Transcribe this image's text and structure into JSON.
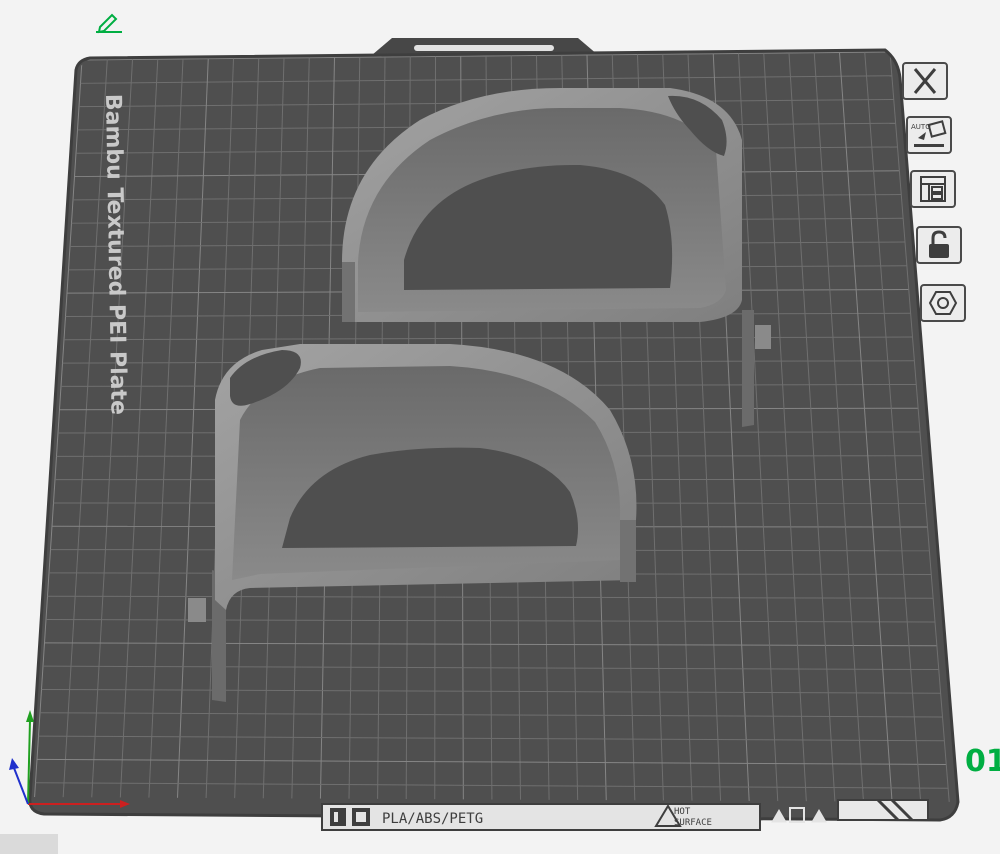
{
  "plate": {
    "name": "Bambu Textured PEI Plate",
    "filament_label": "PLA/ABS/PETG",
    "hot_surface_line1": "HOT",
    "hot_surface_line2": "SURFACE",
    "plate_number": "01"
  },
  "toolbar": {
    "buttons": [
      {
        "name": "close-plate-button",
        "icon": "x-icon"
      },
      {
        "name": "auto-orient-button",
        "icon": "auto-orient-icon",
        "label": "AUTO"
      },
      {
        "name": "arrange-button",
        "icon": "arrange-icon"
      },
      {
        "name": "lock-plate-button",
        "icon": "unlocked-padlock-icon"
      },
      {
        "name": "plate-settings-button",
        "icon": "hex-nut-icon"
      }
    ]
  },
  "icons": {
    "edit": "pencil-icon",
    "axes": "axis-gizmo-icon"
  },
  "colors": {
    "bed": "#4f4f4f",
    "grid": "#6f6f6f",
    "model": "#8e8e8e",
    "accent_green": "#00ae42"
  }
}
